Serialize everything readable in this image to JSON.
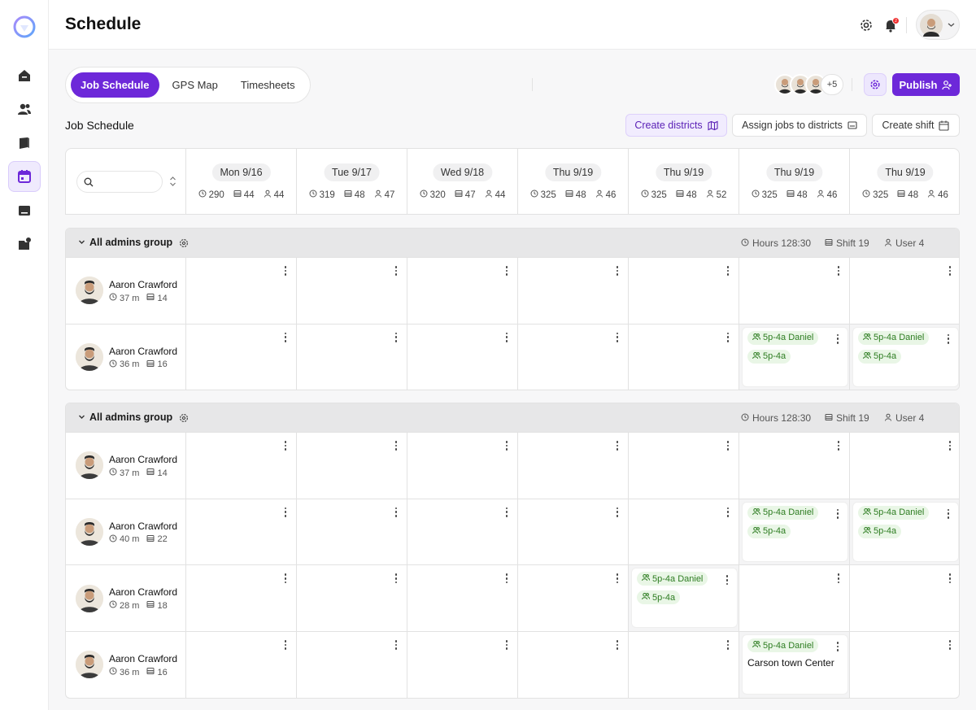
{
  "page": {
    "title": "Schedule"
  },
  "sidebar": {
    "items": [
      "home-icon",
      "users-icon",
      "book-icon",
      "calendar-icon",
      "inbox-icon",
      "folder-badge-icon"
    ],
    "active_index": 3
  },
  "header": {
    "notification_count": "2"
  },
  "tabs": [
    "Job Schedule",
    "GPS Map",
    "Timesheets"
  ],
  "team": {
    "more_label": "+5"
  },
  "actions": {
    "publish": "Publish",
    "create_districts": "Create districts",
    "assign_jobs": "Assign jobs to districts",
    "create_shift": "Create shift"
  },
  "section_title": "Job Schedule",
  "days": [
    {
      "label": "Mon 9/16",
      "hours": "290",
      "shifts": "44",
      "users": "44"
    },
    {
      "label": "Tue 9/17",
      "hours": "319",
      "shifts": "48",
      "users": "47"
    },
    {
      "label": "Wed 9/18",
      "hours": "320",
      "shifts": "47",
      "users": "44"
    },
    {
      "label": "Thu 9/19",
      "hours": "325",
      "shifts": "48",
      "users": "46"
    },
    {
      "label": "Thu 9/19",
      "hours": "325",
      "shifts": "48",
      "users": "52"
    },
    {
      "label": "Thu 9/19",
      "hours": "325",
      "shifts": "48",
      "users": "46"
    },
    {
      "label": "Thu 9/19",
      "hours": "325",
      "shifts": "48",
      "users": "46"
    }
  ],
  "groups": [
    {
      "name": "All admins group",
      "hours_label": "Hours 128:30",
      "shift_label": "Shift 19",
      "user_label": "User 4",
      "rows": [
        {
          "name": "Aaron Crawford",
          "time": "37 m",
          "jobs": "14",
          "shifts": []
        },
        {
          "name": "Aaron Crawford",
          "time": "36 m",
          "jobs": "16",
          "shifts": [
            {
              "day": 5,
              "chip1": "5p-4a Daniel",
              "chip2": "5p-4a"
            },
            {
              "day": 6,
              "chip1": "5p-4a Daniel",
              "chip2": "5p-4a"
            }
          ]
        }
      ]
    },
    {
      "name": "All admins group",
      "hours_label": "Hours 128:30",
      "shift_label": "Shift 19",
      "user_label": "User 4",
      "rows": [
        {
          "name": "Aaron Crawford",
          "time": "37 m",
          "jobs": "14",
          "shifts": []
        },
        {
          "name": "Aaron Crawford",
          "time": "40 m",
          "jobs": "22",
          "shifts": [
            {
              "day": 5,
              "chip1": "5p-4a Daniel",
              "chip2": "5p-4a"
            },
            {
              "day": 6,
              "chip1": "5p-4a Daniel",
              "chip2": "5p-4a"
            }
          ]
        },
        {
          "name": "Aaron Crawford",
          "time": "28  m",
          "jobs": "18",
          "shifts": [
            {
              "day": 4,
              "chip1": "5p-4a Daniel",
              "chip2": "5p-4a"
            }
          ]
        },
        {
          "name": "Aaron Crawford",
          "time": "36 m",
          "jobs": "16",
          "shifts": [
            {
              "day": 5,
              "chip1": "5p-4a Daniel",
              "location": "Carson town Center"
            }
          ]
        }
      ]
    }
  ],
  "colors": {
    "accent": "#6d28d9",
    "chip_bg": "#e9f6e6",
    "chip_text": "#2e7d22"
  }
}
